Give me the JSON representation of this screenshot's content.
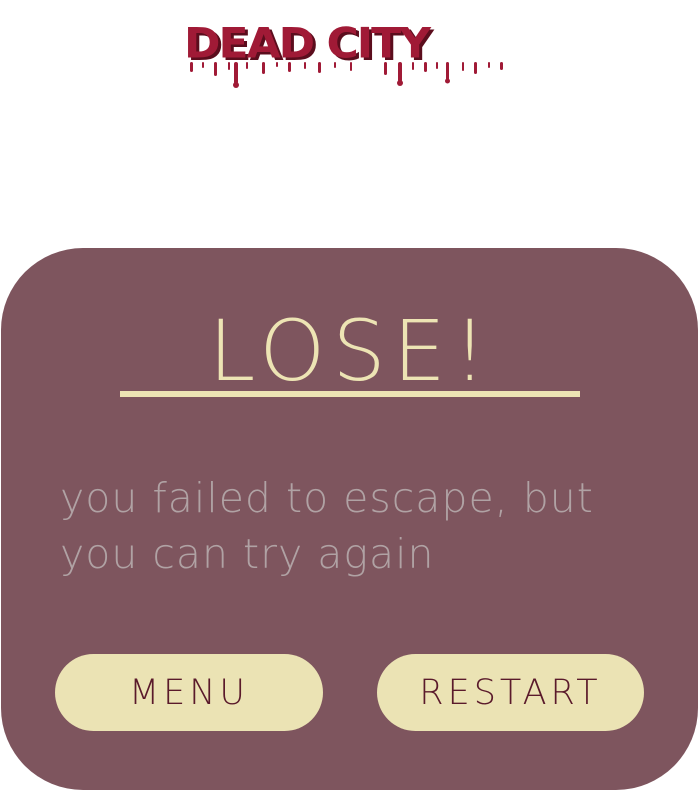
{
  "logo": {
    "text": "DEAD CITY",
    "color": "#a01a36",
    "shadow_color": "#5b0d1d"
  },
  "dialog": {
    "title": "LOSE!",
    "message": "you failed to escape, but you can try again",
    "background_color": "#7e555e",
    "accent_color": "#ede4b4",
    "message_color": "#b0a2a4"
  },
  "buttons": {
    "menu_label": "MENU",
    "restart_label": "RESTART",
    "background_color": "#ebe3b4",
    "text_color": "#5a1a2b"
  }
}
